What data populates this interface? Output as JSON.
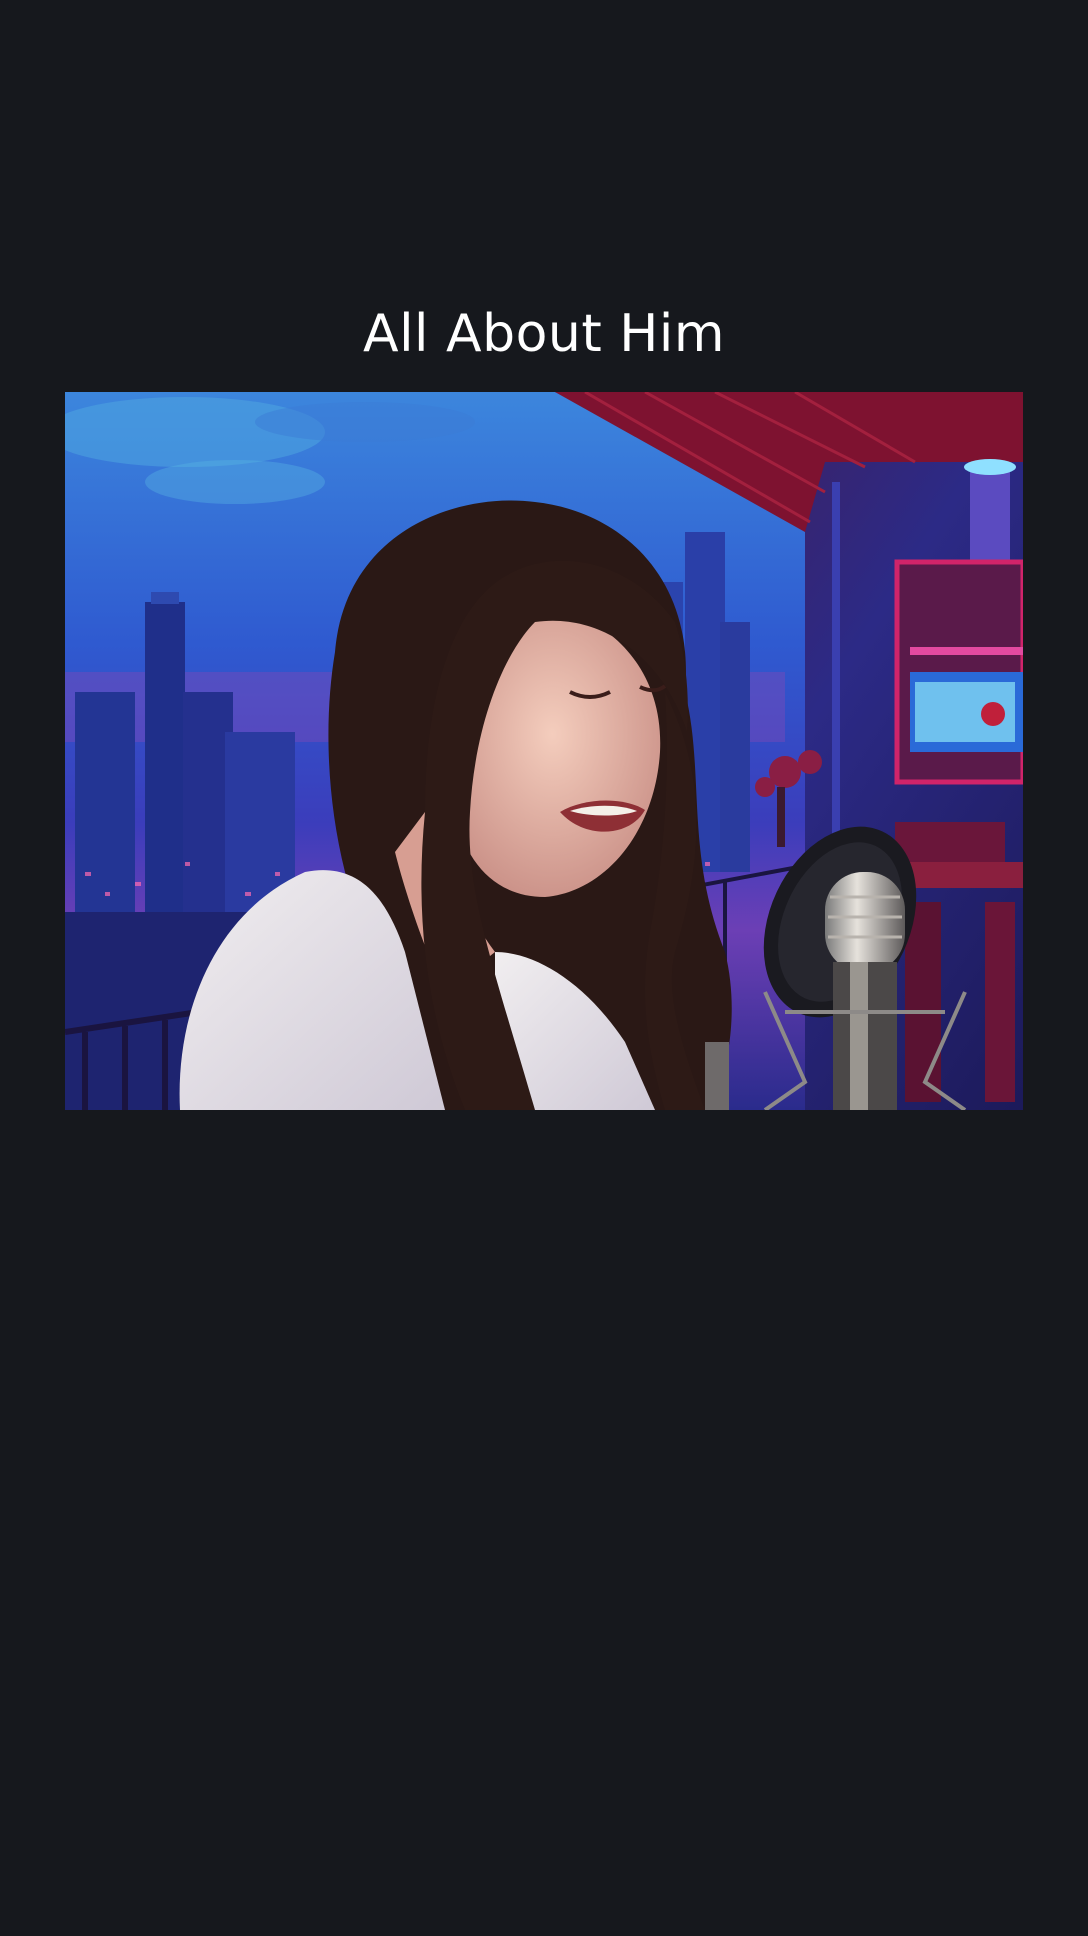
{
  "title": "All About Him",
  "video": {
    "kind": "video-frame",
    "colors": {
      "sky_top": "#3a7bd9",
      "sky_mid": "#2b47c2",
      "sky_dusk": "#6a3fb8",
      "room_red": "#8a1330",
      "room_purple": "#3c2a8a",
      "neon_pink": "#e0308a",
      "shirt": "#e9e6ea",
      "hair": "#2a1a17",
      "skin": "#e8b9a8",
      "background": "#16181d"
    }
  }
}
